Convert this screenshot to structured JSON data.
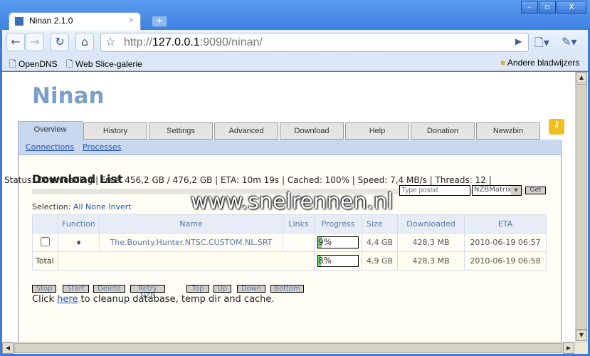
{
  "window": {
    "tab_title": "Ninan 2.1.0",
    "min": "–",
    "max": "▫",
    "close": "X",
    "new_tab": "+"
  },
  "toolbar": {
    "url_scheme": "http://",
    "url_host": "127.0.0.1",
    "url_rest": ":9090/ninan/"
  },
  "bookmarks": [
    {
      "label": "OpenDNS"
    },
    {
      "label": "Web Slice-galerie"
    }
  ],
  "other_bookmarks": "Andere bladwijzers",
  "brand": "Ninan",
  "tabs": [
    "Overview",
    "History",
    "Settings",
    "Advanced",
    "Download",
    "Help",
    "Donation",
    "Newzbin"
  ],
  "subnav": [
    "Connections",
    "Processes"
  ],
  "status": "Status: Downloading | Free: 456,2 GB / 476,2 GB | ETA: 10m 19s | Cached: 100% | Speed: 7,4 MB/s | Threads: 12 |",
  "heading": "Download List",
  "postid_placeholder": "Type postid",
  "source_select": "NZBMatrix",
  "get_label": "Get",
  "selection": {
    "label": "Selection:",
    "all": "All",
    "none": "None",
    "invert": "Invert"
  },
  "watermark": "www.snelrennen.nl",
  "table": {
    "headers": [
      "",
      "Function",
      "Name",
      "Links",
      "Progress",
      "Size",
      "Downloaded",
      "ETA"
    ],
    "rows": [
      {
        "name": "The.Bounty.Hunter.NTSC.CUSTOM.NL.SRT",
        "links": "",
        "progress": 9,
        "progress_label": "9%",
        "size": "4,4 GB",
        "downloaded": "428,3 MB",
        "eta": "2010-06-19 06:57"
      }
    ],
    "total": {
      "label": "Total",
      "progress": 8,
      "progress_label": "8%",
      "size": "4,9 GB",
      "downloaded": "428,3 MB",
      "eta": "2010-06-19 06:58"
    }
  },
  "actions": [
    "Stop",
    "Start",
    "Delete",
    "Retry NZB",
    "Top",
    "Up",
    "Down",
    "Bottom"
  ],
  "cleanup": {
    "pre": "Click ",
    "link": "here",
    "post": " to cleanup database, temp dir and cache."
  }
}
